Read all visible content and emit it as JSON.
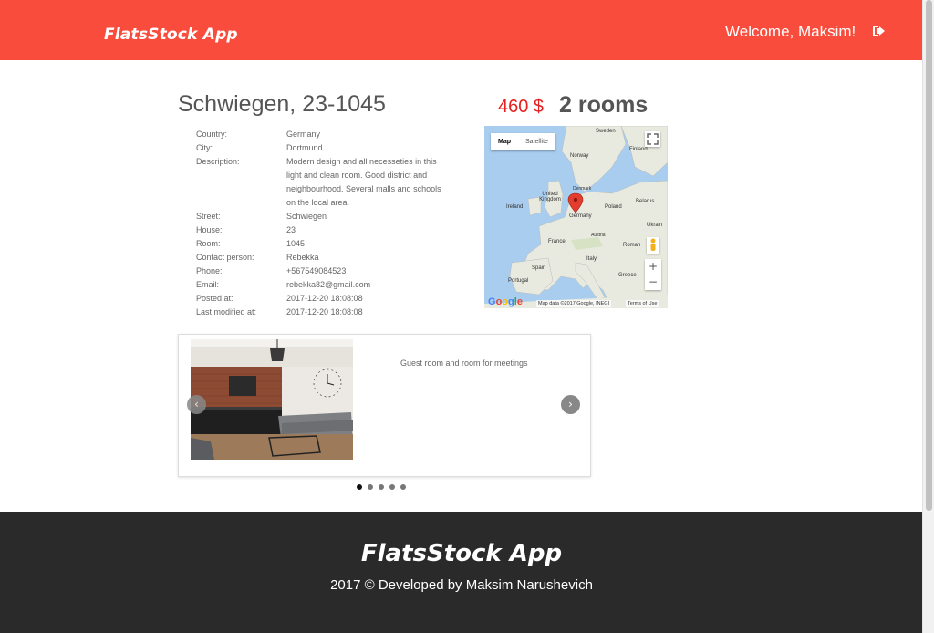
{
  "header": {
    "brand": "FlatsStock App",
    "welcome": "Welcome, Maksim!",
    "logout_icon": "sign-out-icon"
  },
  "flat": {
    "title": "Schwiegen, 23-1045",
    "price": "460 $",
    "rooms": "2 rooms",
    "details": [
      {
        "label": "Country:",
        "value": "Germany"
      },
      {
        "label": "City:",
        "value": "Dortmund"
      },
      {
        "label": "Description:",
        "value": "Modern design and all necesseties in this light and clean room. Good district and neighbourhood. Several malls and schools on the local area."
      },
      {
        "label": "Street:",
        "value": "Schwiegen"
      },
      {
        "label": "House:",
        "value": "23"
      },
      {
        "label": "Room:",
        "value": "1045"
      },
      {
        "label": "Contact person:",
        "value": "Rebekka"
      },
      {
        "label": "Phone:",
        "value": "+567549084523"
      },
      {
        "label": "Email:",
        "value": "rebekka82@gmail.com"
      },
      {
        "label": "Posted at:",
        "value": "2017-12-20 18:08:08"
      },
      {
        "label": "Last modified at:",
        "value": "2017-12-20 18:08:08"
      }
    ]
  },
  "map": {
    "map_tab": "Map",
    "satellite_tab": "Satellite",
    "zoom_in": "+",
    "zoom_out": "−",
    "google": "Google",
    "attribution": "Map data ©2017 Google, INEGI",
    "terms": "Terms of Use",
    "labels": {
      "sweden": "Sweden",
      "finland": "Finland",
      "norway": "Norway",
      "denmark": "Denmark",
      "uk": "United Kingdom",
      "ireland": "Ireland",
      "germany": "Germany",
      "poland": "Poland",
      "belarus": "Belarus",
      "ukraine": "Ukrain",
      "france": "France",
      "austria": "Austria",
      "romania": "Roman",
      "spain": "Spain",
      "italy": "Italy",
      "portugal": "Portugal",
      "greece": "Greece"
    }
  },
  "carousel": {
    "caption": "Guest room and room for meetings",
    "prev": "‹",
    "next": "›",
    "slides": 5,
    "active_slide": 1
  },
  "footer": {
    "brand": "FlatsStock App",
    "copyright": "2017 © Developed by Maksim Narushevich"
  },
  "colors": {
    "header_bg": "#fa4c3c",
    "footer_bg": "#2b2a2a",
    "price": "#e62020"
  }
}
